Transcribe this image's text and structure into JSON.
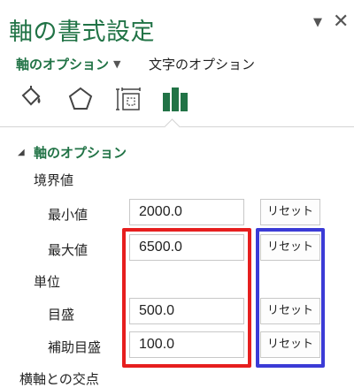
{
  "panel": {
    "title": "軸の書式設定",
    "pin_icon": "▼",
    "close_icon": "✕"
  },
  "options_row": {
    "main_label": "軸のオプション",
    "caret": "▼",
    "text_options_label": "文字のオプション"
  },
  "tabs": [
    {
      "name": "fill-line-icon"
    },
    {
      "name": "effects-icon"
    },
    {
      "name": "size-properties-icon"
    },
    {
      "name": "axis-options-icon",
      "active": true
    }
  ],
  "section": {
    "caret": "◢",
    "title": "軸のオプション",
    "bounds_label": "境界値",
    "min_label": "最小値",
    "min_value": "2000.0",
    "max_label": "最大値",
    "max_value": "6500.0",
    "units_label": "単位",
    "major_label": "目盛",
    "major_value": "500.0",
    "minor_label": "補助目盛",
    "minor_value": "100.0",
    "reset_label": "リセット",
    "cross_label": "横軸との交点"
  },
  "colors": {
    "accent": "#217346",
    "highlight_red": "#e61e1e",
    "highlight_blue": "#3b3bd6"
  }
}
